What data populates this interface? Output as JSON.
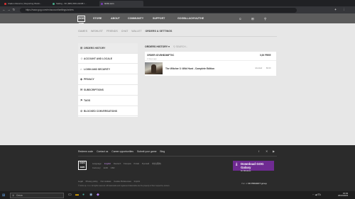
{
  "browser": {
    "tabs": [
      {
        "label": "Cladun Returns | Reporting Worki..."
      },
      {
        "label": "Sailing - 60 (680) 680-HG/98 t..."
      },
      {
        "label": "GOG.com"
      }
    ],
    "address": "https://www.gog.com/en/account/settings/orders"
  },
  "header": {
    "logo": "GOG com",
    "nav": [
      "STORE",
      "ABOUT",
      "COMMUNITY",
      "SUPPORT"
    ],
    "username": "GOGBLLACHYAZTHE"
  },
  "breadcrumb": [
    "GAMES",
    "WISHLIST",
    "FRIENDS",
    "CHAT",
    "WALLET",
    "ORDERS & SETTINGS"
  ],
  "sidebar": {
    "items": [
      {
        "label": "ORDERS HISTORY",
        "icon": "cart-icon"
      },
      {
        "label": "ACCOUNT AND LOCALE",
        "icon": "person-icon"
      },
      {
        "label": "LOGIN AND SECURITY",
        "icon": "lock-icon"
      },
      {
        "label": "PRIVACY",
        "icon": "shield-icon"
      },
      {
        "label": "SUBSCRIPTIONS",
        "icon": "mail-icon"
      },
      {
        "label": "TAGS",
        "icon": "tag-icon"
      },
      {
        "label": "BLOCKED CONVERSATIONS",
        "icon": "block-icon"
      }
    ]
  },
  "orders": {
    "filter_label": "ORDERS HISTORY",
    "search_label": "SEARCH...",
    "order": {
      "id": "ORDER #DV8H8D66FT0C",
      "date": "2 days ago",
      "total": "0,00 FREE",
      "item": "The Witcher 3: Wild Hunt - Complete Edition",
      "status": "refunded",
      "price": "$0.00"
    }
  },
  "footer": {
    "links": [
      "Redeem code",
      "Contact us",
      "Career opportunities",
      "Submit your game",
      "Blog"
    ],
    "logo": "GOG com",
    "language_label": "Language:",
    "languages": [
      "English",
      "Deutsch",
      "Français",
      "Polski",
      "Русский",
      "中文(简体)"
    ],
    "currency_label": "Currency:",
    "currencies": [
      "EUR",
      "USD"
    ],
    "galaxy_title": "Download GOG Galaxy",
    "galaxy_sub": "for Windows",
    "legal_links": [
      "Legal",
      "Privacy policy",
      "Our cookies",
      "Cookie Preferences",
      "Imprint"
    ],
    "copyright": "© GOG sp. z o.o. All rights reserved. All trademarks and registered trademarks are the property of their respective owners.",
    "part_of": "Part of",
    "cdpr": "CD PROJEKT group"
  },
  "taskbar": {
    "search": "Cerca",
    "time": "15:03",
    "date": "23/10/2023",
    "tray": "ITA"
  }
}
